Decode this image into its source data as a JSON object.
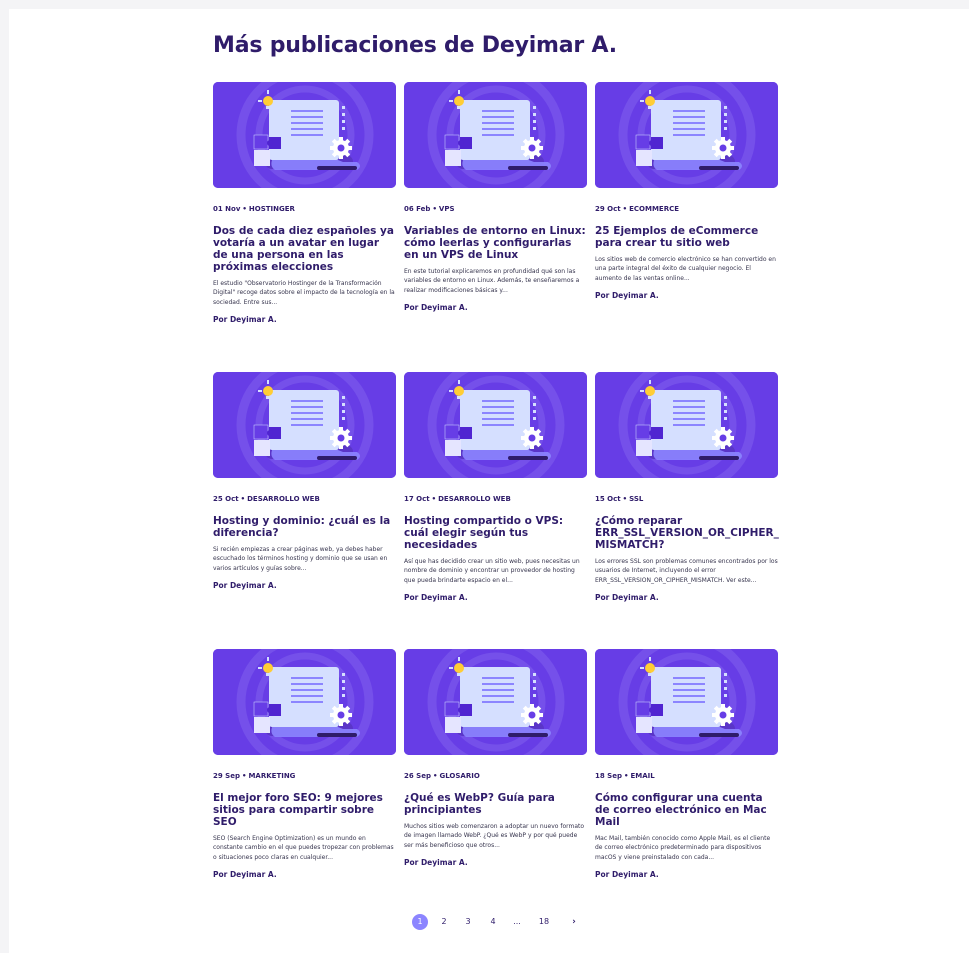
{
  "section_title": "Más publicaciones de Deyimar A.",
  "colors": {
    "accent": "#673de6",
    "title": "#2f1c6a",
    "page_active": "#8c85ff"
  },
  "posts": [
    {
      "date": "01 Nov",
      "category": "HOSTINGER",
      "title": "Dos de cada diez españoles ya votaría a un avatar en lugar de una persona en las próximas elecciones",
      "excerpt": "El estudio \"Observatorio Hostinger de la Transformación Digital\" recoge datos sobre el impacto de la tecnología en la sociedad. Entre sus...",
      "author": "Por Deyimar A."
    },
    {
      "date": "06 Feb",
      "category": "VPS",
      "title": "Variables de entorno en Linux: cómo leerlas y configurarlas en un VPS de Linux",
      "excerpt": "En este tutorial explicaremos en profundidad qué son las variables de entorno en Linux. Además, te enseñaremos a realizar modificaciones básicas y...",
      "author": "Por Deyimar A."
    },
    {
      "date": "29 Oct",
      "category": "ECOMMERCE",
      "title": "25 Ejemplos de eCommerce para crear tu sitio web",
      "excerpt": "Los sitios web de comercio electrónico se han convertido en una parte integral del éxito de cualquier negocio. El aumento de las ventas online...",
      "author": "Por Deyimar A."
    },
    {
      "date": "25 Oct",
      "category": "DESARROLLO WEB",
      "title": "Hosting y dominio: ¿cuál es la diferencia?",
      "excerpt": "Si recién empiezas a crear páginas web, ya debes haber escuchado los términos hosting y dominio que se usan en varios artículos y guías sobre...",
      "author": "Por Deyimar A."
    },
    {
      "date": "17 Oct",
      "category": "DESARROLLO WEB",
      "title": "Hosting compartido o VPS: cuál elegir según tus necesidades",
      "excerpt": "Así que has decidido crear un sitio web, pues necesitas un nombre de dominio y encontrar un proveedor de hosting que pueda brindarte espacio en el...",
      "author": "Por Deyimar A."
    },
    {
      "date": "15 Oct",
      "category": "SSL",
      "title": "¿Cómo reparar ERR_SSL_VERSION_OR_CIPHER_ MISMATCH?",
      "excerpt": "Los errores SSL son problemas comunes encontrados por los usuarios de Internet, incluyendo el error ERR_SSL_VERSION_OR_CIPHER_MISMATCH. Ver este...",
      "author": "Por Deyimar A."
    },
    {
      "date": "29 Sep",
      "category": "MARKETING",
      "title": "El mejor foro SEO: 9 mejores sitios para compartir sobre SEO",
      "excerpt": "SEO (Search Engine Optimization) es un mundo en constante cambio en el que puedes tropezar con problemas o situaciones poco claras en cualquier...",
      "author": "Por Deyimar A."
    },
    {
      "date": "26 Sep",
      "category": "GLOSARIO",
      "title": "¿Qué es WebP? Guía para principiantes",
      "excerpt": "Muchos sitios web comenzaron a adoptar un nuevo formato de imagen llamado WebP. ¿Qué es WebP y por qué puede ser más beneficioso que otros...",
      "author": "Por Deyimar A."
    },
    {
      "date": "18 Sep",
      "category": "EMAIL",
      "title": "Cómo configurar una cuenta de correo electrónico en Mac Mail",
      "excerpt": "Mac Mail, también conocido como Apple Mail, es el cliente de correo electrónico predeterminado para dispositivos macOS y viene preinstalado con cada...",
      "author": "Por Deyimar A."
    }
  ],
  "pagination": {
    "current": "1",
    "pages": [
      "2",
      "3",
      "4"
    ],
    "ellipsis": "...",
    "last": "18",
    "next_icon": "chevron-right-icon",
    "next_symbol": "›"
  }
}
